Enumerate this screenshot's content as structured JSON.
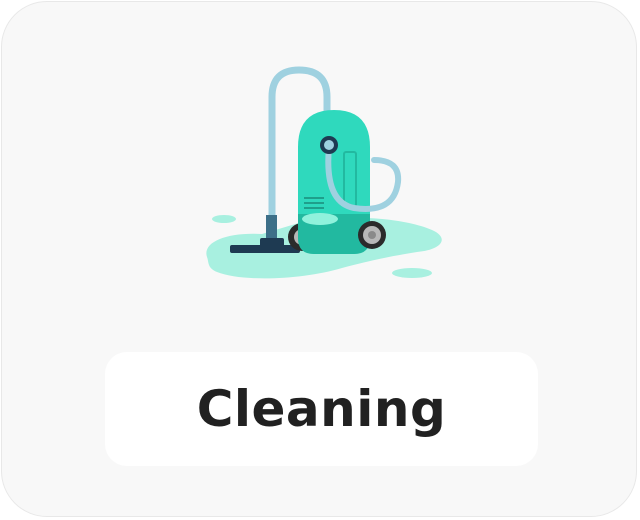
{
  "card": {
    "label": "Cleaning",
    "icon": "vacuum-cleaner-icon"
  },
  "colors": {
    "card_background": "#f8f8f8",
    "label_background": "#ffffff",
    "label_text": "#212121",
    "vacuum_body": "#2fd9bd",
    "vacuum_shade": "#22b9a0",
    "hose": "#9fd1e0",
    "puddle": "#a8f0e0"
  }
}
